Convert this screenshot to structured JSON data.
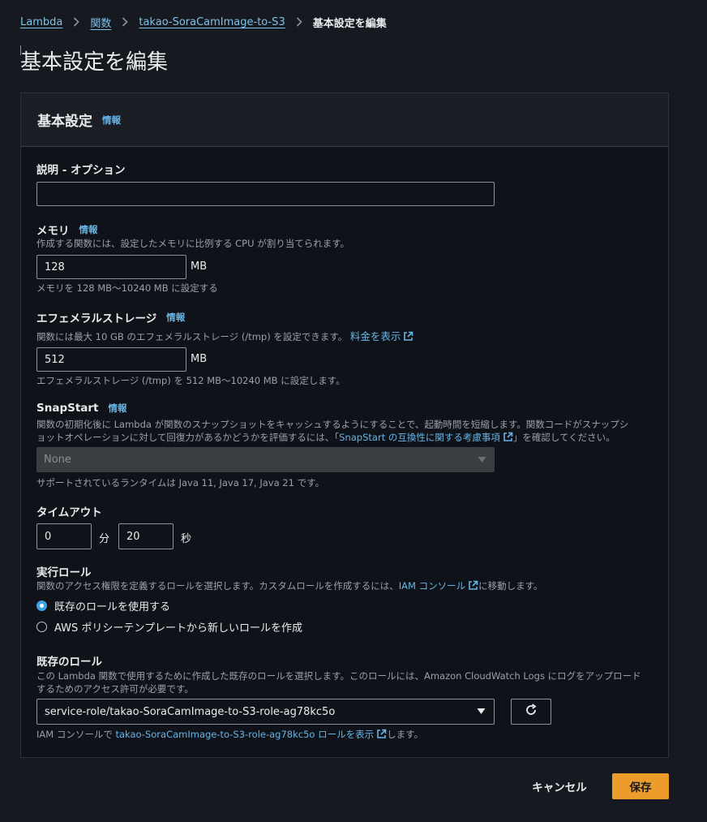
{
  "breadcrumb": {
    "items": [
      "Lambda",
      "関数",
      "takao-SoraCamImage-to-S3"
    ],
    "current": "基本設定を編集"
  },
  "page_title": "基本設定を編集",
  "panel": {
    "title": "基本設定",
    "info": "情報"
  },
  "description_field": {
    "label": "説明 - オプション",
    "value": ""
  },
  "memory": {
    "label": "メモリ",
    "info": "情報",
    "help": "作成する関数には、設定したメモリに比例する CPU が割り当てられます。",
    "value": "128",
    "unit": "MB",
    "constraint": "メモリを 128 MB〜10240 MB に設定する"
  },
  "ephemeral": {
    "label": "エフェメラルストレージ",
    "info": "情報",
    "help": "関数には最大 10 GB のエフェメラルストレージ (/tmp) を設定できます。",
    "pricing_link": "料金を表示",
    "value": "512",
    "unit": "MB",
    "constraint": "エフェメラルストレージ (/tmp) を 512 MB〜10240 MB に設定します。"
  },
  "snapstart": {
    "label": "SnapStart",
    "info": "情報",
    "help_line1": "関数の初期化後に Lambda が関数のスナップショットをキャッシュするようにすることで、起動時間を短縮します。関数コードがスナップシ",
    "help_line2_pre": "ョットオペレーションに対して回復力があるかどうかを評価するには、「",
    "help_link": "SnapStart の互換性に関する考慮事項",
    "help_line2_post": "」を確認してください。",
    "selected": "None",
    "runtimes": "サポートされているランタイムは Java 11, Java 17, Java 21 です。"
  },
  "timeout": {
    "label": "タイムアウト",
    "minutes": "0",
    "minutes_unit": "分",
    "seconds": "20",
    "seconds_unit": "秒"
  },
  "exec_role": {
    "label": "実行ロール",
    "help_pre": "関数のアクセス権限を定義するロールを選択します。カスタムロールを作成するには、",
    "help_link": "IAM コンソール",
    "help_post": "に移動します。",
    "options": [
      {
        "label": "既存のロールを使用する",
        "checked": true
      },
      {
        "label": "AWS ポリシーテンプレートから新しいロールを作成",
        "checked": false
      }
    ]
  },
  "existing_role": {
    "label": "既存のロール",
    "help_line1": "この Lambda 関数で使用するために作成した既存のロールを選択します。このロールには、Amazon CloudWatch Logs にログをアップロード",
    "help_line2": "するためのアクセス許可が必要です。",
    "selected": "service-role/takao-SoraCamImage-to-S3-role-ag78kc5o",
    "footer_pre": "IAM コンソールで ",
    "footer_link": "takao-SoraCamImage-to-S3-role-ag78kc5o ロールを表示",
    "footer_post": "します。"
  },
  "actions": {
    "cancel": "キャンセル",
    "save": "保存"
  },
  "colors": {
    "background": "#16191f",
    "link": "#66b5e6",
    "primary": "#ec9c2b",
    "radio_selected": "#3ea3e4"
  }
}
